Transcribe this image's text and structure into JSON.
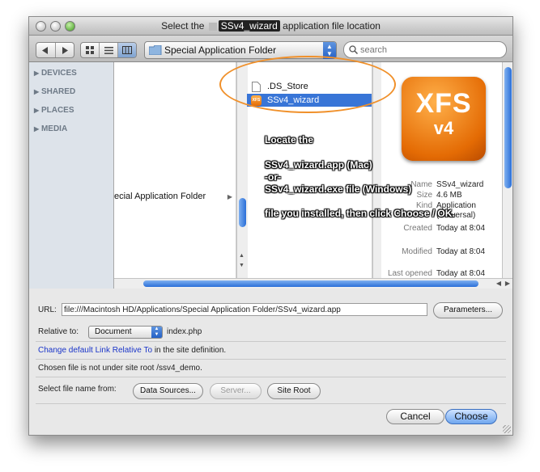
{
  "window": {
    "title_prefix": "Select the",
    "title_app": "SSv4_wizard",
    "title_suffix": "application file location"
  },
  "toolbar": {
    "back_icon": "left-arrow-icon",
    "forward_icon": "right-arrow-icon",
    "view_icons": [
      "icon-view-icon",
      "list-view-icon",
      "column-view-icon"
    ],
    "folder_popup_value": "Special Application Folder",
    "search_placeholder": "search"
  },
  "sidebar": {
    "items": [
      {
        "label": "DEVICES"
      },
      {
        "label": "SHARED"
      },
      {
        "label": "PLACES"
      },
      {
        "label": "MEDIA"
      }
    ]
  },
  "browser": {
    "col1_item": "ecial Application Folder",
    "col2_items": [
      {
        "label": ".DS_Store",
        "icon": "document-icon"
      },
      {
        "label": "SSv4_wizard",
        "icon": "app-icon",
        "selected": true
      }
    ],
    "preview": {
      "logo_line1": "XFS",
      "logo_line2": "v4",
      "name_label": "Name",
      "name_value": "SSv4_wizard",
      "size_label": "Size",
      "size_value": "4.6 MB",
      "kind_label": "Kind",
      "kind_value": "Application (Universal)",
      "created_label": "Created",
      "created_value": "Today at 8:04",
      "modified_label": "Modified",
      "modified_value": "Today at 8:04",
      "opened_label": "Last opened",
      "opened_value": "Today at 8:04"
    }
  },
  "annotation": {
    "line1": "Locate the",
    "line2": "SSv4_wizard.app (Mac)",
    "line3": "-or-",
    "line4": "SSv4_wizard.exe file (Windows)",
    "line5": "file you installed, then click Choose / OK."
  },
  "form": {
    "url_label": "URL:",
    "url_value": "file:///Macintosh HD/Applications/Special Application Folder/SSv4_wizard.app",
    "parameters_button": "Parameters...",
    "relative_label": "Relative to:",
    "relative_value": "Document",
    "relative_file": "index.php",
    "change_link": "Change default Link Relative To",
    "change_suffix": "in the site definition.",
    "root_note": "Chosen file is not under site root /ssv4_demo.",
    "select_label": "Select file name from:",
    "data_sources_button": "Data Sources...",
    "server_button": "Server...",
    "site_root_button": "Site Root",
    "cancel_button": "Cancel",
    "choose_button": "Choose"
  },
  "colors": {
    "selection": "#3875d7",
    "accent_ellipse": "#f0902a",
    "link": "#1a35c9"
  }
}
